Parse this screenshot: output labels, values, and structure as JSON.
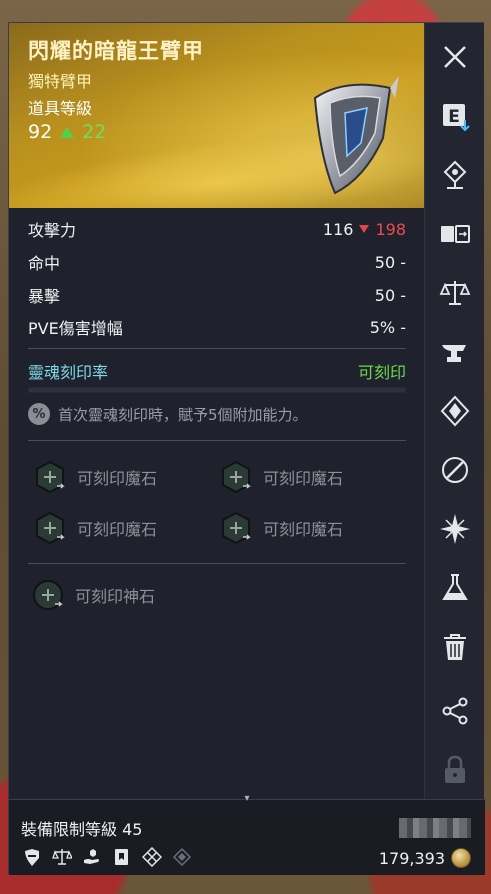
{
  "item": {
    "name": "閃耀的暗龍王臂甲",
    "grade": "獨特臂甲",
    "level_label": "道具等級",
    "level": "92",
    "level_upgrade": "22"
  },
  "stats": [
    {
      "name": "攻擊力",
      "value": "116",
      "compare": "198",
      "compare_dir": "down"
    },
    {
      "name": "命中",
      "value": "50 -"
    },
    {
      "name": "暴擊",
      "value": "50 -"
    },
    {
      "name": "PVE傷害增幅",
      "value": "5% -"
    }
  ],
  "soul": {
    "label": "靈魂刻印率",
    "status": "可刻印",
    "info_icon": "%",
    "info": "首次靈魂刻印時，賦予5個附加能力。"
  },
  "slots": [
    {
      "label": "可刻印魔石"
    },
    {
      "label": "可刻印魔石"
    },
    {
      "label": "可刻印魔石"
    },
    {
      "label": "可刻印魔石"
    },
    {
      "label": "可刻印神石"
    }
  ],
  "sidebar": [
    {
      "icon": "close-icon"
    },
    {
      "icon": "equip-e-icon",
      "glyph": "E"
    },
    {
      "icon": "location-pin-icon"
    },
    {
      "icon": "compare-cards-icon"
    },
    {
      "icon": "scale-icon"
    },
    {
      "icon": "anvil-icon"
    },
    {
      "icon": "diamond-emblem-icon"
    },
    {
      "icon": "cycle-slash-icon"
    },
    {
      "icon": "star-burst-icon"
    },
    {
      "icon": "flask-icon"
    },
    {
      "icon": "trash-icon"
    },
    {
      "icon": "share-icon"
    },
    {
      "icon": "lock-icon"
    }
  ],
  "footer": {
    "requirement": "裝備限制等級 45",
    "price": "179,393",
    "icons": [
      "armor-icon",
      "scale-icon",
      "hand-trade-icon",
      "book-icon",
      "diamond-grid-icon",
      "fade-diamond-icon"
    ]
  },
  "colors": {
    "header_gold": "#c79a1c",
    "soul_label": "#7fd8e6",
    "status_green": "#6ed84e",
    "compare_red": "#ee4a4e",
    "panel_bg": "#1f222c"
  }
}
